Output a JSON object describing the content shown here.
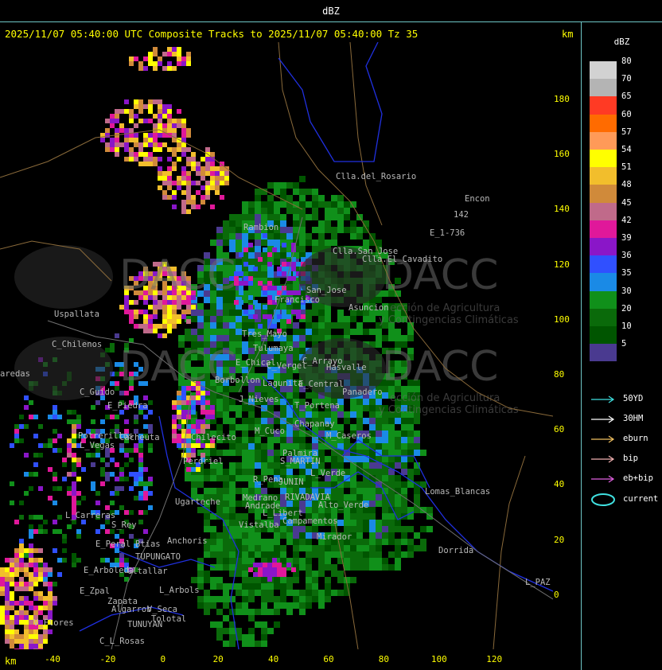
{
  "header": {
    "title": "dBZ"
  },
  "map_header": {
    "title": "2025/11/07 05:40:00 UTC Composite Tracks to 2025/11/07 05:40:00 Tz 35",
    "unit_top": "km",
    "unit_bottom": "km"
  },
  "axes": {
    "y_ticks": [
      "180",
      "160",
      "140",
      "120",
      "100",
      "80",
      "60",
      "40",
      "20",
      "0"
    ],
    "x_ticks": [
      "-40",
      "-20",
      "0",
      "20",
      "40",
      "60",
      "80",
      "100",
      "120"
    ]
  },
  "legend": {
    "title": "dBZ",
    "scale": [
      {
        "value": "80",
        "color": "#d2d2d2"
      },
      {
        "value": "70",
        "color": "#b4b4b4"
      },
      {
        "value": "65",
        "color": "#ff3a24"
      },
      {
        "value": "60",
        "color": "#ff6b00"
      },
      {
        "value": "57",
        "color": "#ff9a58"
      },
      {
        "value": "54",
        "color": "#ffff00"
      },
      {
        "value": "51",
        "color": "#f2be2c"
      },
      {
        "value": "48",
        "color": "#d08a3a"
      },
      {
        "value": "45",
        "color": "#c06a8a"
      },
      {
        "value": "42",
        "color": "#e0189a"
      },
      {
        "value": "39",
        "color": "#8a16c8"
      },
      {
        "value": "36",
        "color": "#3050ff"
      },
      {
        "value": "35",
        "color": "#1a8ae6"
      },
      {
        "value": "30",
        "color": "#10901a"
      },
      {
        "value": "20",
        "color": "#0a6a0a"
      },
      {
        "value": "10",
        "color": "#005500"
      },
      {
        "value": "5",
        "color": "#4a3a90"
      }
    ],
    "tracks": [
      {
        "label": "50YD",
        "color": "#40e0e0"
      },
      {
        "label": "30HM",
        "color": "#ffffff"
      },
      {
        "label": "eburn",
        "color": "#f0c060"
      },
      {
        "label": "bip",
        "color": "#f0b0b0"
      },
      {
        "label": "eb+bip",
        "color": "#e060e0"
      }
    ],
    "current_label": "current",
    "current_color": "#40e0e0"
  },
  "watermark": {
    "text": "DACC",
    "line1": "ección de Agricultura",
    "line2": "y Contingencias Climáticas"
  },
  "places": [
    "Clla.del_Rosario",
    "Encon",
    "142",
    "E_1-736",
    "Rambion",
    "Clla.San_Jose",
    "Clla.El_Cavadito",
    "San_Jose",
    "Francisco",
    "Asuncion",
    "Uspallata",
    "C_Chilenos",
    "aredas",
    "Tres_Mayo",
    "Tulumaya",
    "E_Chical",
    "C_Vergel",
    "C_Arrayo",
    "Hasvalle",
    "Borbollon",
    "Lagunita",
    "E_Central",
    "Panadero",
    "C_Guido",
    "E_Piedra",
    "J_Nieves",
    "T_Portena",
    "Potrerillos",
    "Cacheuta",
    "L_Vegas",
    "Chapanay",
    "M_Cuco",
    "M_Caseros",
    "Palmira",
    "S_MARTIN",
    "JUNIN",
    "Perdriel",
    "Ugarteche",
    "R_Pena",
    "L_Verde",
    "Medrano",
    "RIVADAVIA",
    "Andrade",
    "Alto_Verde",
    "L_Libert",
    "Campamentos",
    "L_Carreras",
    "S_Rey",
    "Mirador",
    "Lomas_Blancas",
    "Dorrida",
    "L_PAZ",
    "Anchoris",
    "E_Peral",
    "Btias",
    "TUPUNGATO",
    "E_Arboleda",
    "Gltallar",
    "E_Zpal",
    "L_Arbols",
    "Zapata",
    "Algarrob",
    "V_Seca",
    "Tolotal",
    "TUNUYAN",
    "C_L_Rosas",
    "V_Flores",
    "Chilecito",
    "Vistalba",
    "Puntual"
  ]
}
